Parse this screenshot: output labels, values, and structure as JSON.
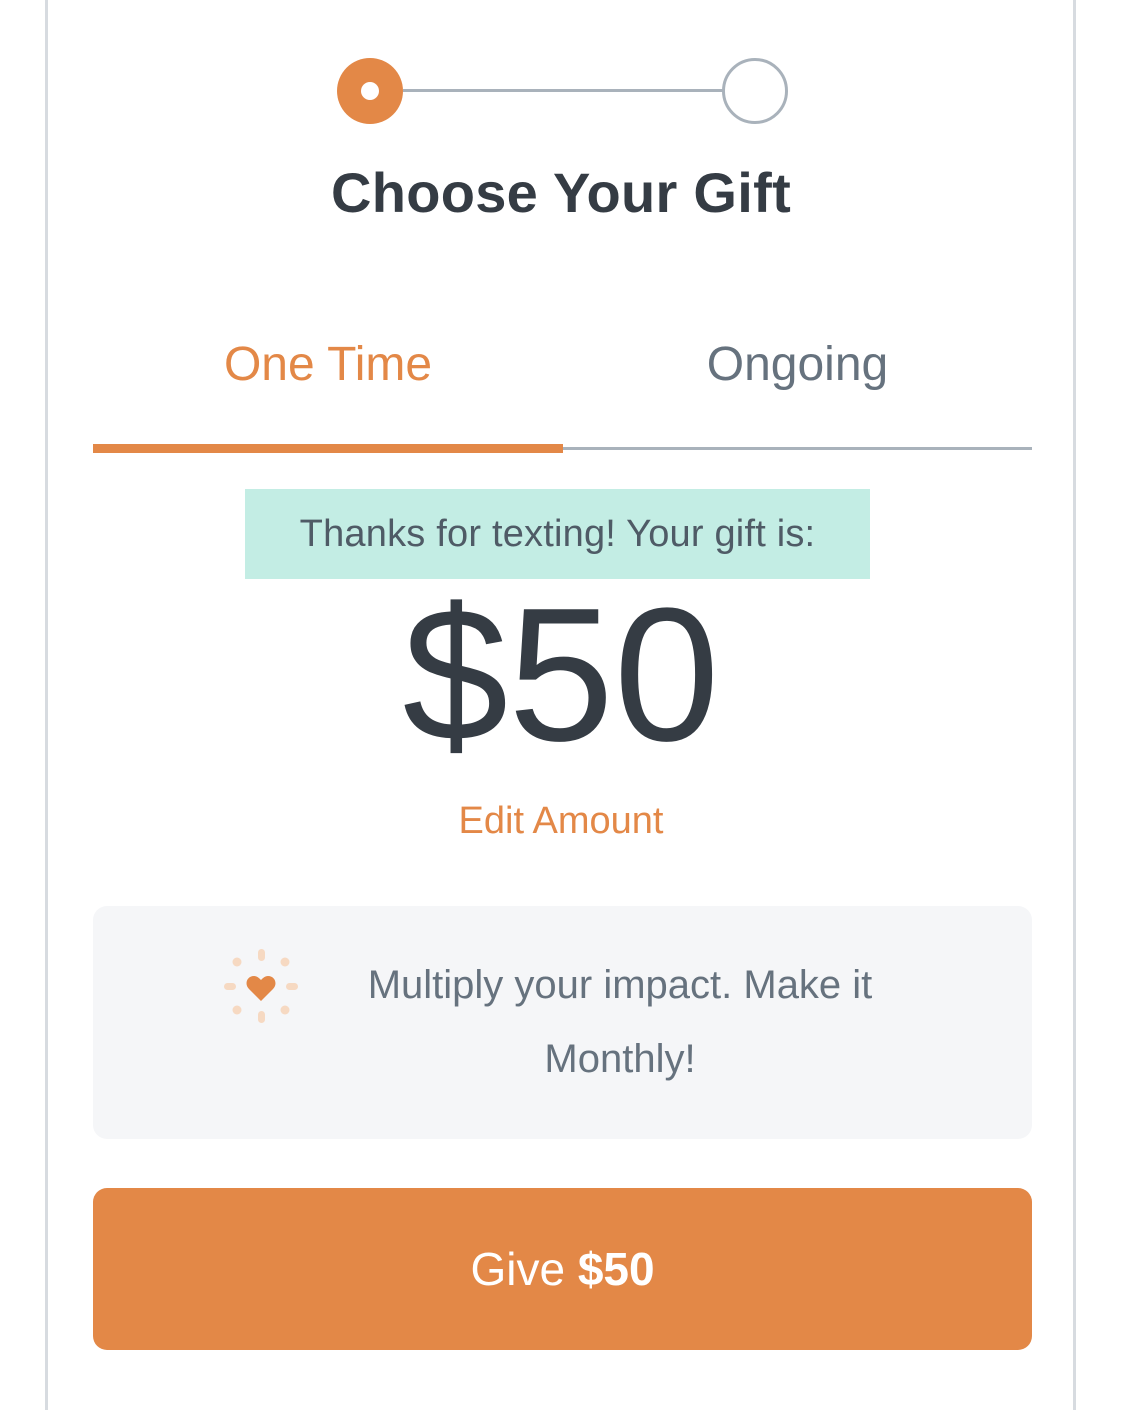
{
  "stepper": {
    "steps": [
      "active",
      "inactive"
    ]
  },
  "title": "Choose Your Gift",
  "tabs": [
    {
      "label": "One Time",
      "selected": true
    },
    {
      "label": "Ongoing",
      "selected": false
    }
  ],
  "banner": {
    "text": "Thanks for texting! Your gift is:"
  },
  "amount": "$50",
  "edit_amount_label": "Edit Amount",
  "monthly_prompt": {
    "icon": "heart-sparkle-icon",
    "text": "Multiply your impact. Make it Monthly!"
  },
  "give_button": {
    "prefix": "Give",
    "amount": "$50"
  },
  "colors": {
    "accent": "#e38847",
    "text_dark": "#353c44",
    "text_muted": "#66727e",
    "banner_bg": "#c3ede4",
    "box_bg": "#f5f6f8"
  }
}
